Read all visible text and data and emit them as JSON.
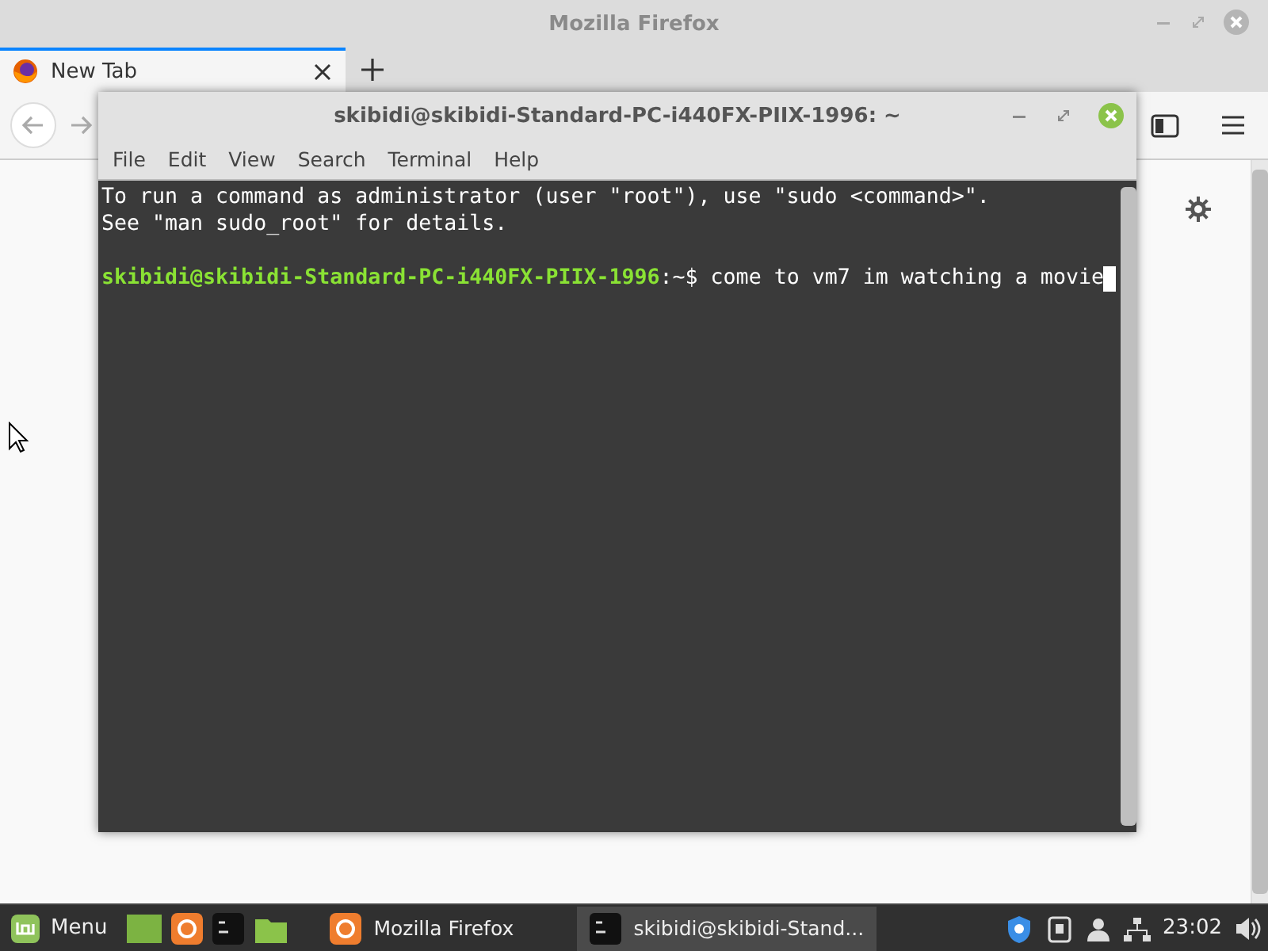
{
  "browser": {
    "title": "Mozilla Firefox",
    "tabs": [
      {
        "label": "New Tab",
        "selected": true
      }
    ]
  },
  "terminal": {
    "title": "skibidi@skibidi-Standard-PC-i440FX-PIIX-1996: ~",
    "menu": [
      "File",
      "Edit",
      "View",
      "Search",
      "Terminal",
      "Help"
    ],
    "output": [
      "To run a command as administrator (user \"root\"), use \"sudo <command>\".",
      "See \"man sudo_root\" for details."
    ],
    "prompt": {
      "user_host": "skibidi@skibidi-Standard-PC-i440FX-PIIX-1996",
      "suffix": ":~$",
      "command": "come to vm7 im watching a movie"
    }
  },
  "taskbar": {
    "menu_label": "Menu",
    "windows": [
      {
        "kind": "firefox",
        "label": "Mozilla Firefox",
        "selected": false
      },
      {
        "kind": "terminal",
        "label": "skibidi@skibidi-Stand...",
        "selected": true
      }
    ],
    "clock": "23:02"
  }
}
